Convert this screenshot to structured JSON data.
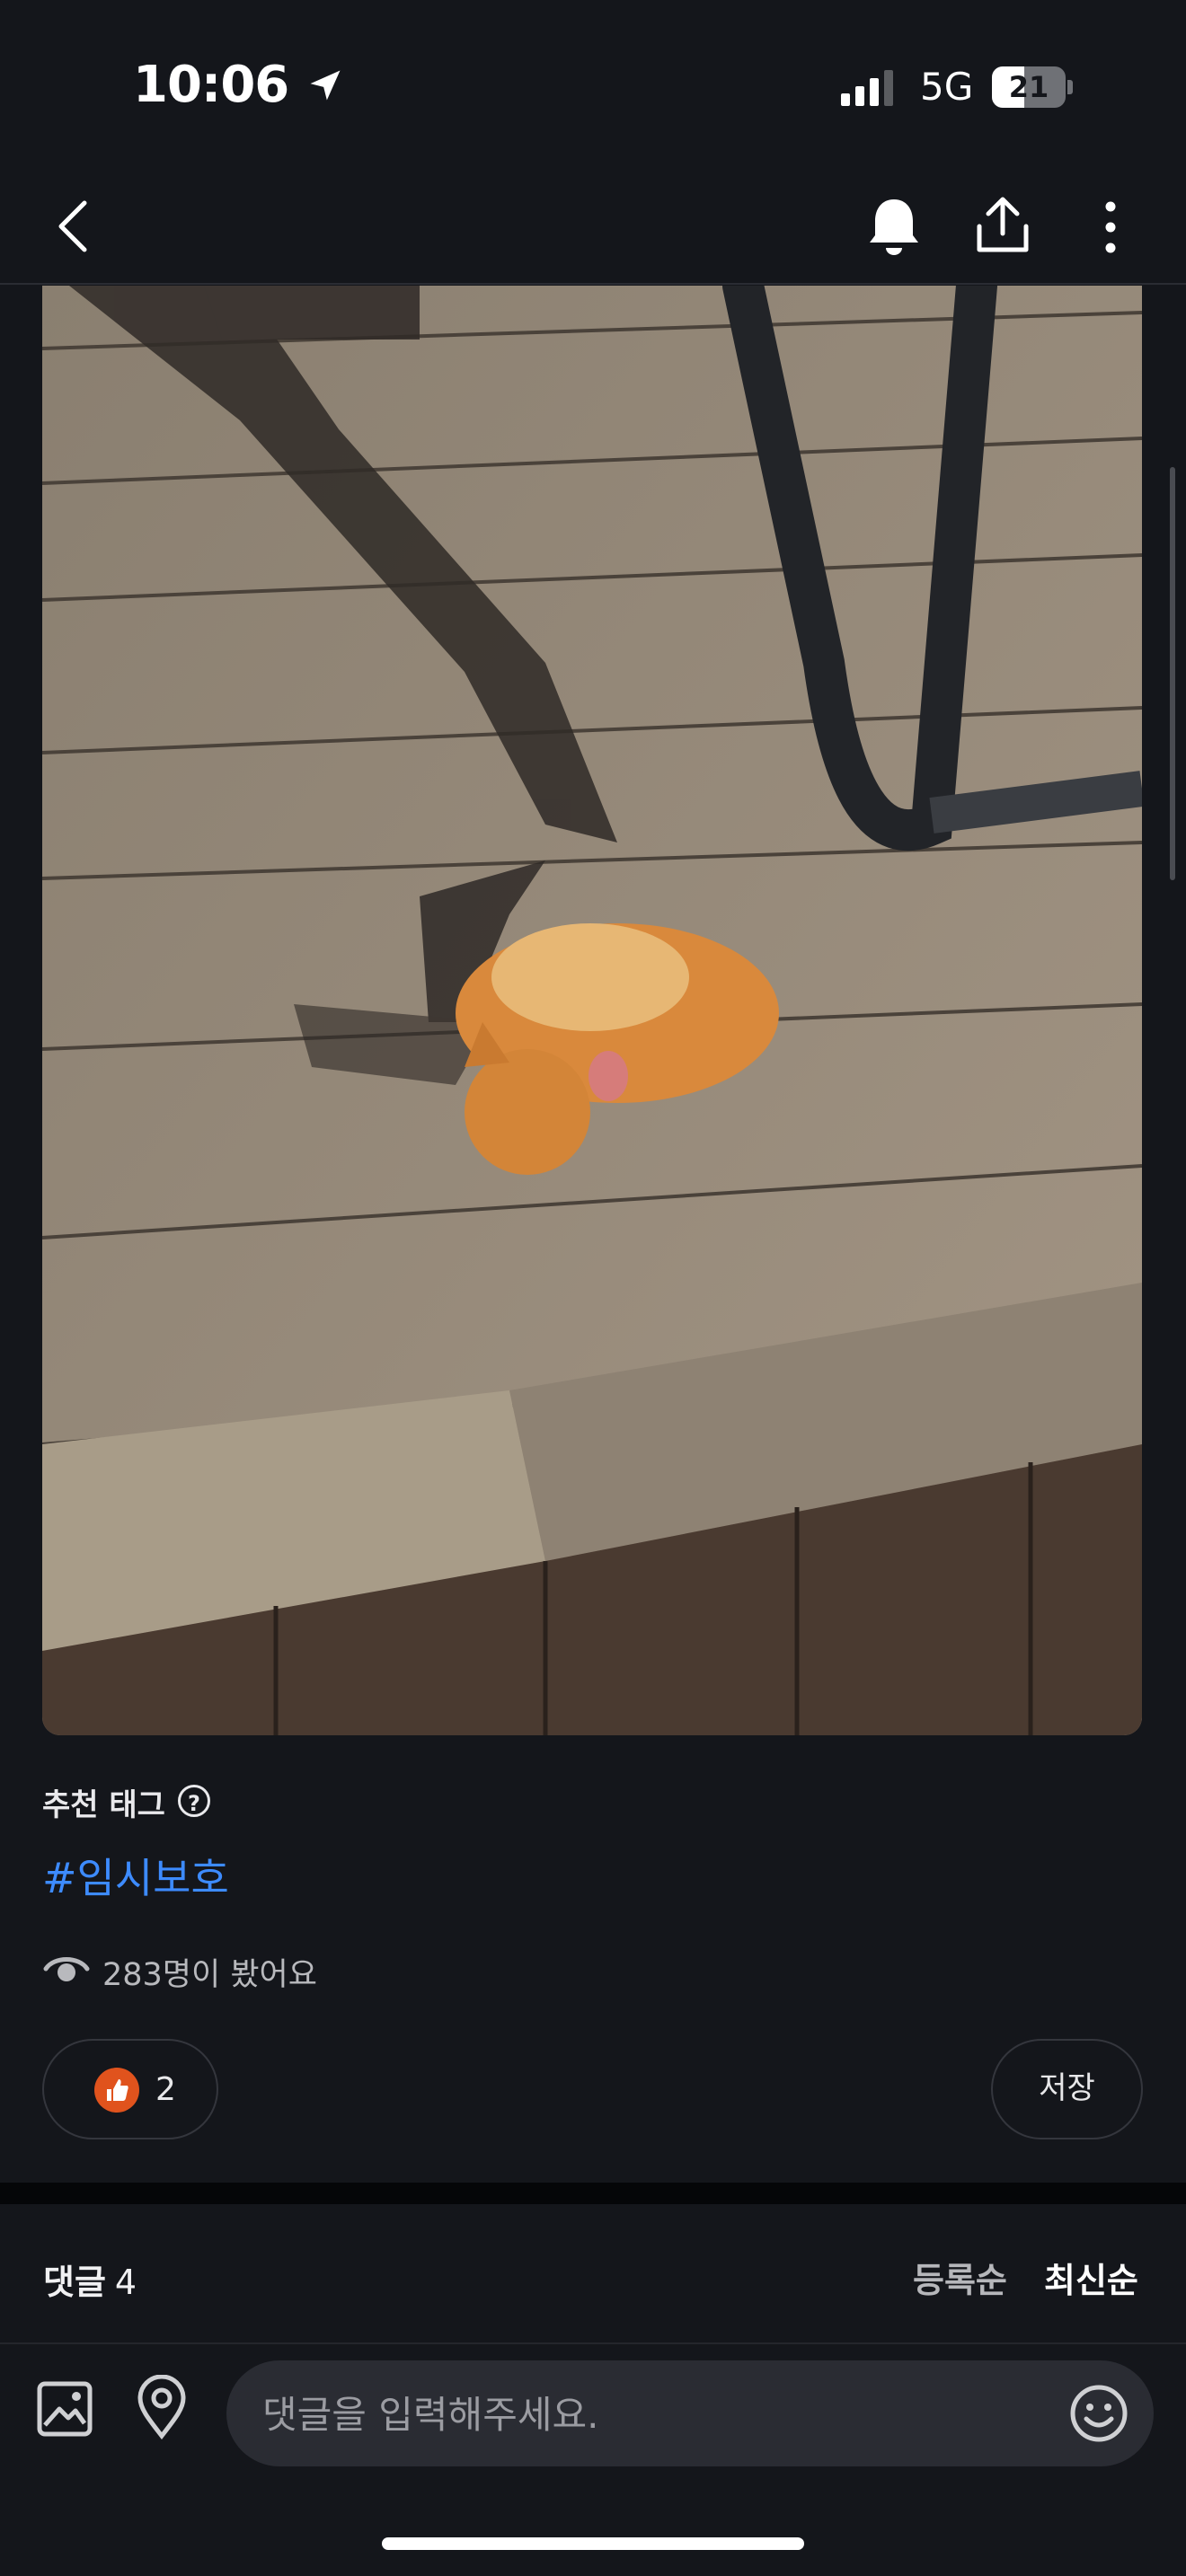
{
  "status_bar": {
    "time": "10:06",
    "network": "5G",
    "battery": "21"
  },
  "header": {
    "icons": [
      "back-icon",
      "bell-icon",
      "share-icon",
      "more-icon"
    ]
  },
  "post": {
    "recommended_tag_title": "추천 태그",
    "hashtag": "#임시보호",
    "views_text": "283명이 봤어요",
    "like_count": "2",
    "save_label": "저장"
  },
  "comments": {
    "label": "댓글",
    "count": "4",
    "sort_registered": "등록순",
    "sort_latest": "최신순",
    "input_placeholder": "댓글을 입력해주세요."
  },
  "colors": {
    "background": "#14161b",
    "hashtag": "#3d8bff",
    "like": "#e0531d"
  }
}
